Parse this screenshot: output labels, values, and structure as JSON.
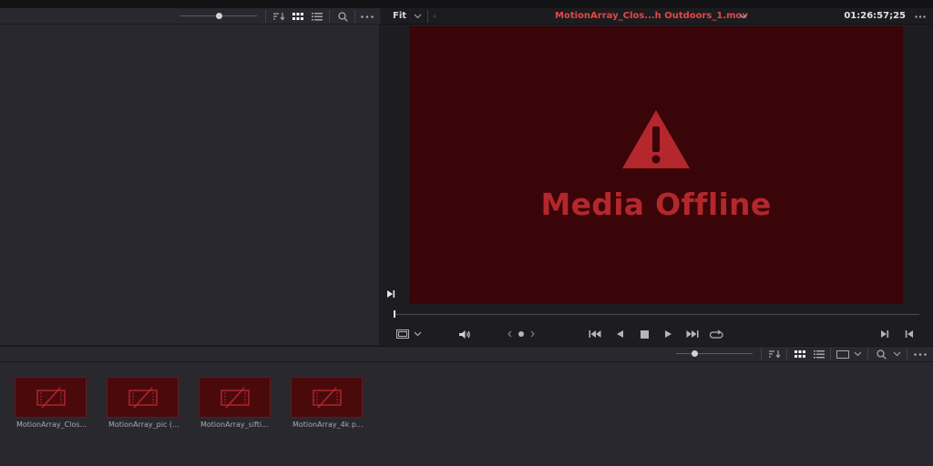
{
  "viewer": {
    "fit_label": "Fit",
    "clip_name": "MotionArray_Clos...h Outdoors_1.mov",
    "timecode": "01:26:57;25",
    "offline_message": "Media Offline",
    "accent_color": "#e04848",
    "offline_frame_color": "#3a0508"
  },
  "toolbar": {
    "sort_icon": "sort-icon",
    "grid_view_icon": "grid-view-icon",
    "list_view_icon": "list-view-icon",
    "search_icon": "search-icon",
    "more_icon": "more-options-icon"
  },
  "transport": {
    "controls": [
      "jump-to-start",
      "play-reverse",
      "stop",
      "play",
      "jump-to-end",
      "loop"
    ]
  },
  "bin": {
    "clips": [
      {
        "label": "MotionArray_Clos..."
      },
      {
        "label": "MotionArray_pic (..."
      },
      {
        "label": "MotionArray_sifti..."
      },
      {
        "label": "MotionArray_4k p..."
      }
    ]
  }
}
